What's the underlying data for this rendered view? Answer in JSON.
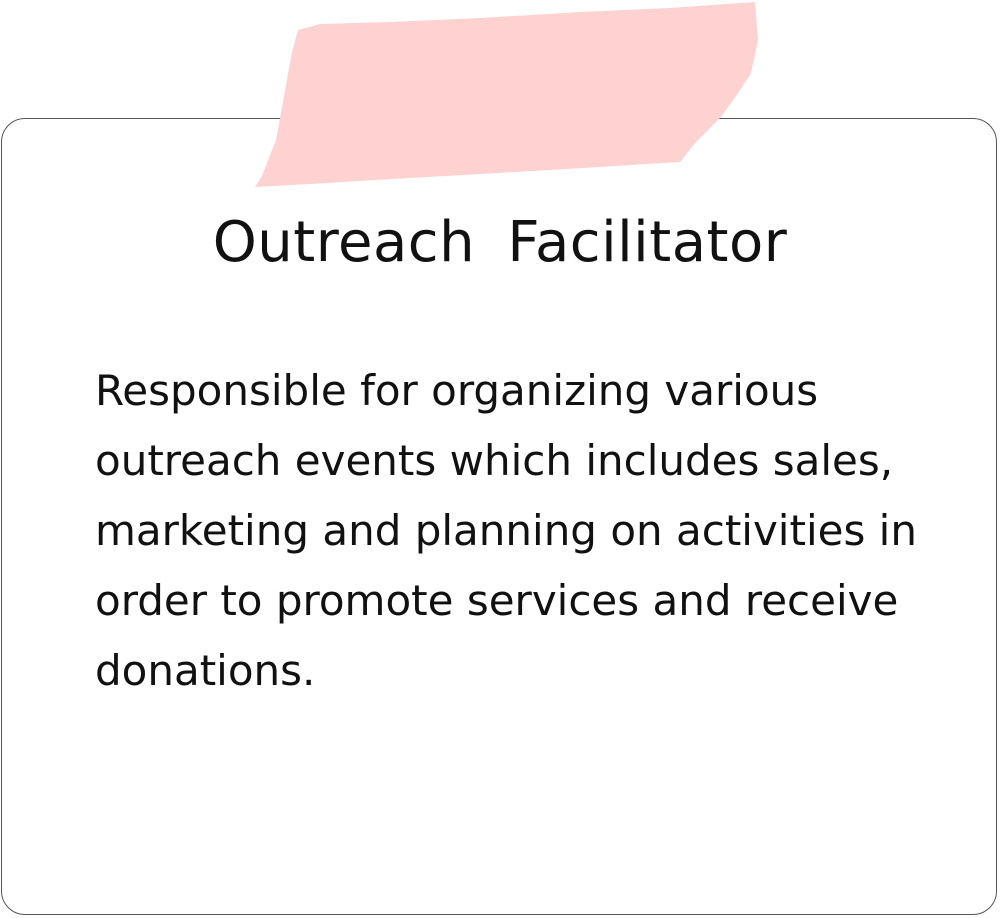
{
  "card": {
    "title": "Outreach Facilitator",
    "description_lines": [
      "Responsible for organizing various",
      "outreach events which includes sales,",
      "marketing and planning on activities in",
      "order to promote services and receive",
      "donations."
    ]
  },
  "colors": {
    "tape": "#ffd2d2",
    "border": "#555555",
    "text": "#111111"
  }
}
